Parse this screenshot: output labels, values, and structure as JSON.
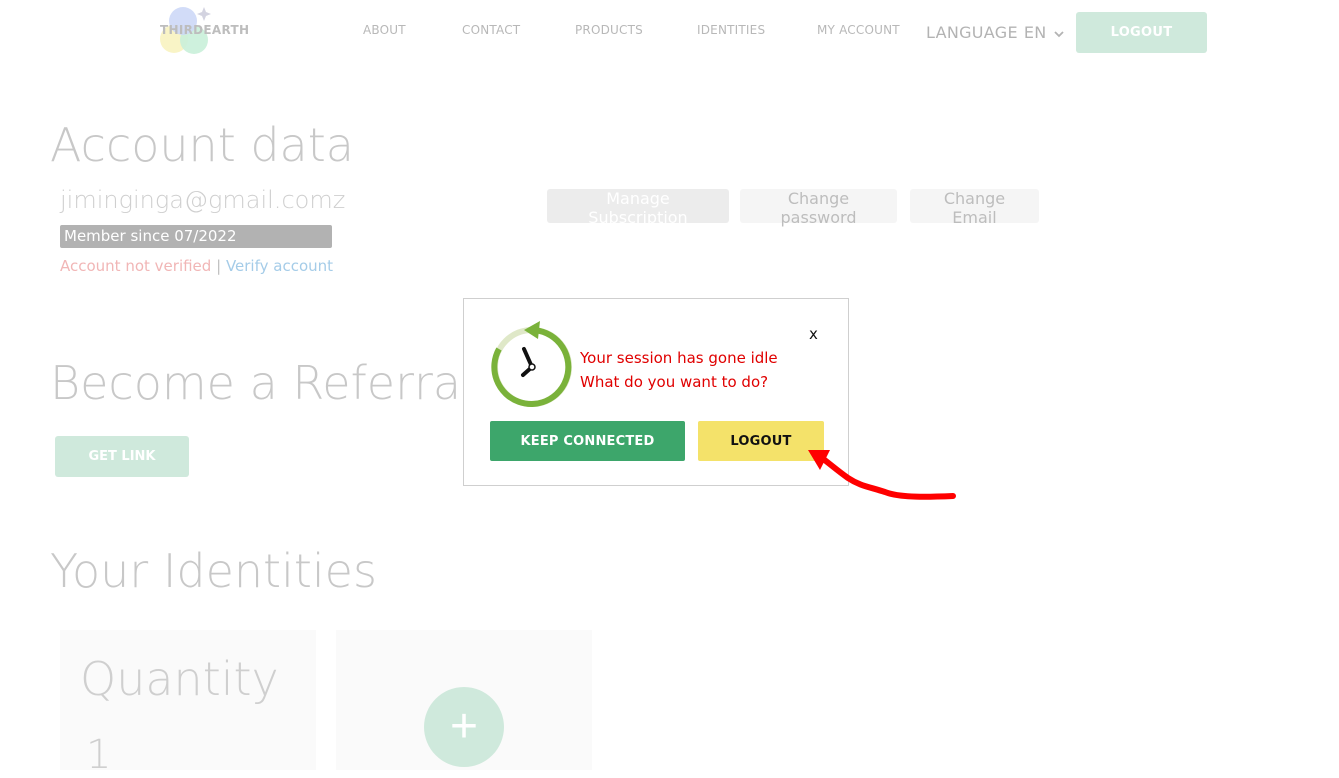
{
  "header": {
    "brand": "THIRDEARTH",
    "nav": [
      "ABOUT",
      "CONTACT",
      "PRODUCTS",
      "IDENTITIES",
      "MY ACCOUNT"
    ],
    "language_label": "LANGUAGE",
    "language_code": "EN",
    "logout_label": "LOGOUT"
  },
  "account": {
    "title": "Account data",
    "email": "jiminginga@gmail.comz",
    "member_since": "Member since 07/2022",
    "not_verified": "Account not verified",
    "separator": "|",
    "verify_link": "Verify account",
    "buttons": [
      "Manage Subscription",
      "Change password",
      "Change Email"
    ]
  },
  "referral": {
    "title": "Become a Referral",
    "get_link_label": "GET LINK"
  },
  "identities": {
    "title": "Your Identities",
    "quantity_label": "Quantity",
    "quantity_value": "1",
    "add_symbol": "+"
  },
  "modal": {
    "close_label": "x",
    "line1": "Your session has gone idle",
    "line2": "What do you want to do?",
    "keep_label": "KEEP CONNECTED",
    "logout_label": "LOGOUT"
  },
  "colors": {
    "accent_green": "#3da66b",
    "logout_yellow": "#f4e26a",
    "idle_red": "#e00000",
    "annotation_red": "#ff0000"
  }
}
